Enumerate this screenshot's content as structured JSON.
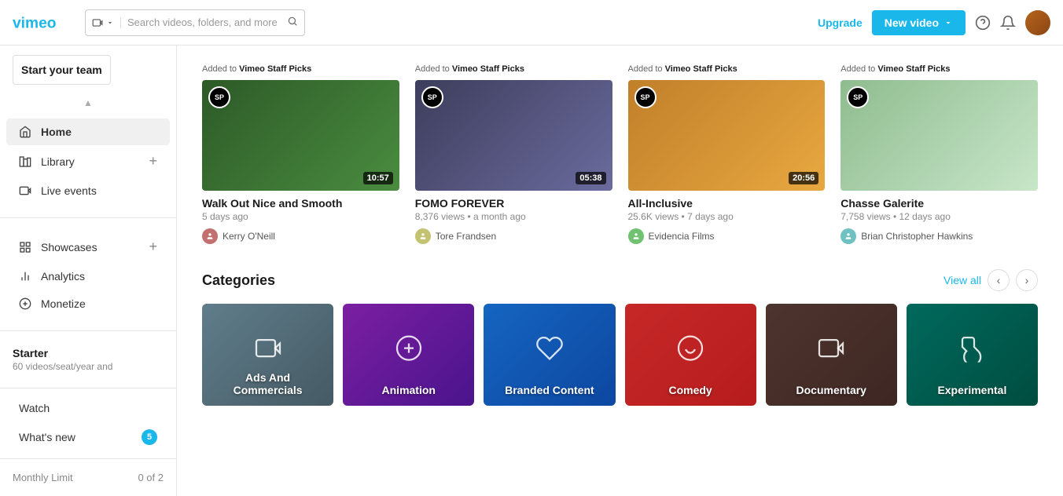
{
  "header": {
    "logo_alt": "Vimeo",
    "search_placeholder": "Search videos, folders, and more",
    "upgrade_label": "Upgrade",
    "new_video_label": "New video",
    "search_type": "video-icon"
  },
  "sidebar": {
    "start_team_label": "Start your team",
    "nav_items": [
      {
        "id": "home",
        "label": "Home",
        "icon": "home",
        "active": true
      },
      {
        "id": "library",
        "label": "Library",
        "icon": "library",
        "has_plus": true
      },
      {
        "id": "live-events",
        "label": "Live events",
        "icon": "live"
      }
    ],
    "nav_items2": [
      {
        "id": "showcases",
        "label": "Showcases",
        "icon": "showcases",
        "has_plus": true
      },
      {
        "id": "analytics",
        "label": "Analytics",
        "icon": "analytics"
      },
      {
        "id": "monetize",
        "label": "Monetize",
        "icon": "monetize"
      }
    ],
    "plan": {
      "title": "Starter",
      "subtitle": "60 videos/seat/year and"
    },
    "bottom_items": [
      {
        "id": "watch",
        "label": "Watch"
      },
      {
        "id": "whats-new",
        "label": "What's new",
        "badge": 5
      }
    ],
    "monthly_limit_label": "Monthly Limit",
    "monthly_limit_value": "0 of 2"
  },
  "staff_picks": {
    "section_label": "Added to",
    "collection_name": "Vimeo Staff Picks",
    "cards": [
      {
        "title": "Walk Out Nice and Smooth",
        "meta": "5 days ago",
        "author": "Kerry O'Neill",
        "duration": "10:57",
        "thumb_class": "thumb-1"
      },
      {
        "title": "FOMO FOREVER",
        "meta": "8,376 views • a month ago",
        "author": "Tore Frandsen",
        "duration": "05:38",
        "thumb_class": "thumb-2"
      },
      {
        "title": "All-Inclusive",
        "meta": "25.6K views • 7 days ago",
        "author": "Evidencia Films",
        "duration": "20:56",
        "thumb_class": "thumb-3"
      },
      {
        "title": "Chasse Galerite",
        "meta": "7,758 views • 12 days ago",
        "author": "Brian Christopher Hawkins",
        "duration": "",
        "thumb_class": "thumb-4"
      }
    ]
  },
  "categories": {
    "title": "Categories",
    "view_all_label": "View all",
    "items": [
      {
        "id": "ads",
        "label": "Ads And Commercials",
        "icon": "🎬",
        "css_class": "cat-ads"
      },
      {
        "id": "animation",
        "label": "Animation",
        "icon": "🎨",
        "css_class": "cat-animation"
      },
      {
        "id": "branded",
        "label": "Branded Content",
        "icon": "📢",
        "css_class": "cat-branded"
      },
      {
        "id": "comedy",
        "label": "Comedy",
        "icon": "😂",
        "css_class": "cat-comedy"
      },
      {
        "id": "documentary",
        "label": "Documentary",
        "icon": "🎥",
        "css_class": "cat-documentary"
      },
      {
        "id": "experimental",
        "label": "Experimental",
        "icon": "✨",
        "css_class": "cat-experimental"
      }
    ]
  }
}
